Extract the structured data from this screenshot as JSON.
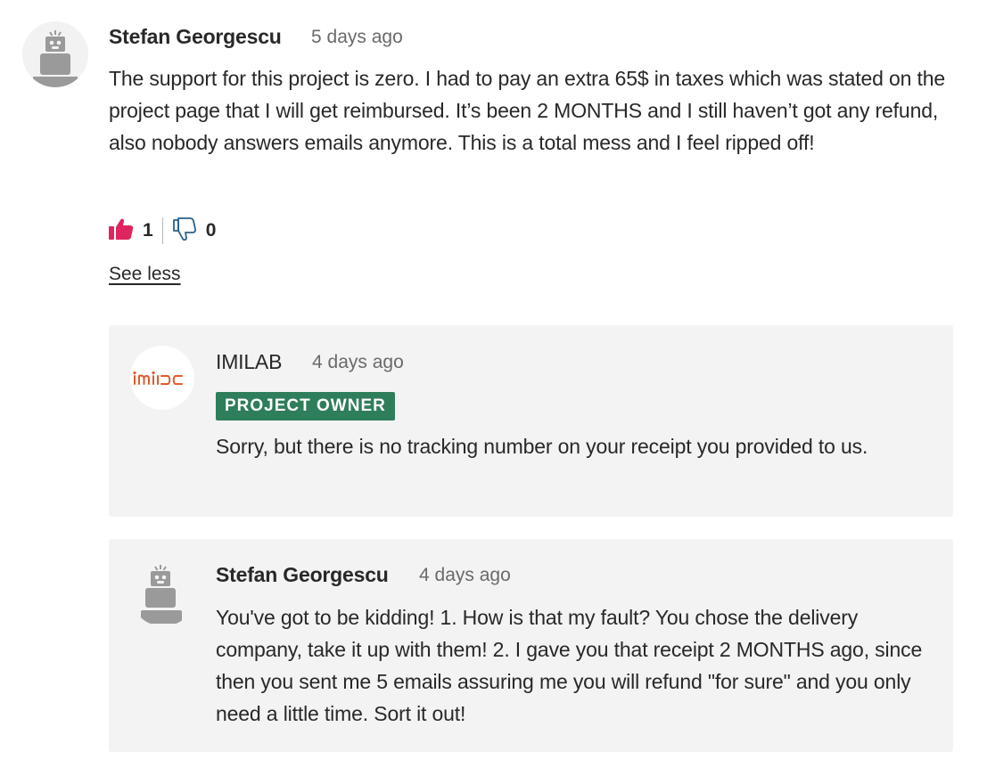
{
  "main_comment": {
    "author": "Stefan Georgescu",
    "timestamp": "5 days ago",
    "text": "The support for this project is zero. I had to pay an extra 65$ in taxes which was stated on the project page that I will get reimbursed. It’s been 2 MONTHS and I still haven’t got any refund, also nobody answers emails anymore. This is a total mess and I feel ripped off!",
    "likes": "1",
    "dislikes": "0",
    "see_less_label": "See less",
    "avatar_icon": "robot-avatar-icon"
  },
  "replies": [
    {
      "author": "IMILAB",
      "timestamp": "4 days ago",
      "badge": "PROJECT OWNER",
      "text": "Sorry, but there is no tracking number on your receipt you provided to us.",
      "logo_text": "imilab",
      "avatar_icon": "imilab-logo-icon"
    },
    {
      "author": "Stefan Georgescu",
      "timestamp": "4 days ago",
      "text": "You've got to be kidding! 1. How is that my fault? You chose the delivery company, take it up with them! 2. I gave you that receipt 2 MONTHS ago, since then you sent me 5 emails assuring me you will refund \"for sure\" and you only need a little time. Sort it out!",
      "avatar_icon": "robot-avatar-icon"
    }
  ],
  "colors": {
    "like_active": "#e0245e",
    "dislike_outline": "#2a5f8a",
    "badge_bg": "#2e7d5b",
    "card_bg": "#f3f3f3",
    "logo_orange": "#e05a2b"
  }
}
